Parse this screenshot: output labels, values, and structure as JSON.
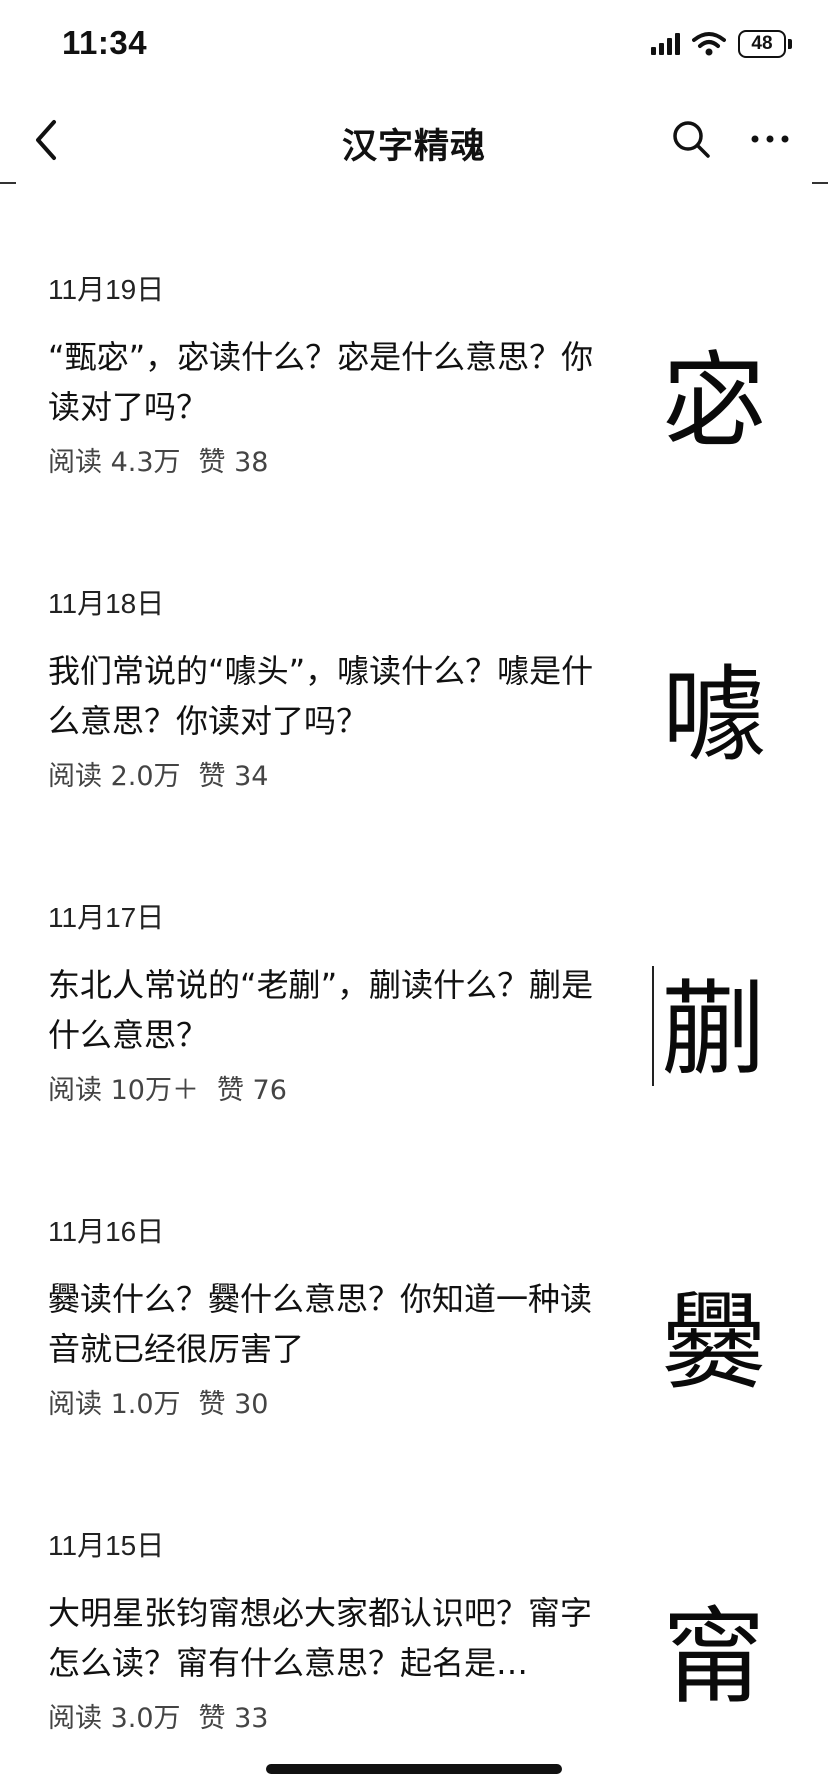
{
  "status_bar": {
    "time": "11:34",
    "battery": "48",
    "icons": [
      "signal-icon",
      "wifi-icon",
      "battery-icon"
    ]
  },
  "nav": {
    "title": "汉字精魂",
    "icons": [
      "back-chevron-icon",
      "search-icon",
      "more-icon"
    ]
  },
  "articles": [
    {
      "date": "11月19日",
      "title": "“甄宓”，宓读什么？宓是什么意思？你读对了吗？",
      "reads": "阅读 4.3万",
      "likes": "赞 38",
      "character": "宓"
    },
    {
      "date": "11月18日",
      "title": "我们常说的“噱头”，噱读什么？噱是什么意思？你读对了吗？",
      "reads": "阅读 2.0万",
      "likes": "赞 34",
      "character": "噱"
    },
    {
      "date": "11月17日",
      "title": "东北人常说的“老蒯”，蒯读什么？蒯是什么意思？",
      "reads": "阅读 10万＋",
      "likes": "赞 76",
      "character": "蒯"
    },
    {
      "date": "11月16日",
      "title": "爨读什么？爨什么意思？你知道一种读音就已经很厉害了",
      "reads": "阅读 1.0万",
      "likes": "赞 30",
      "character": "爨"
    },
    {
      "date": "11月15日",
      "title": "大明星张钧甯想必大家都认识吧？甯字怎么读？甯有什么意思？起名是…",
      "reads": "阅读 3.0万",
      "likes": "赞 33",
      "character": "甯"
    }
  ]
}
